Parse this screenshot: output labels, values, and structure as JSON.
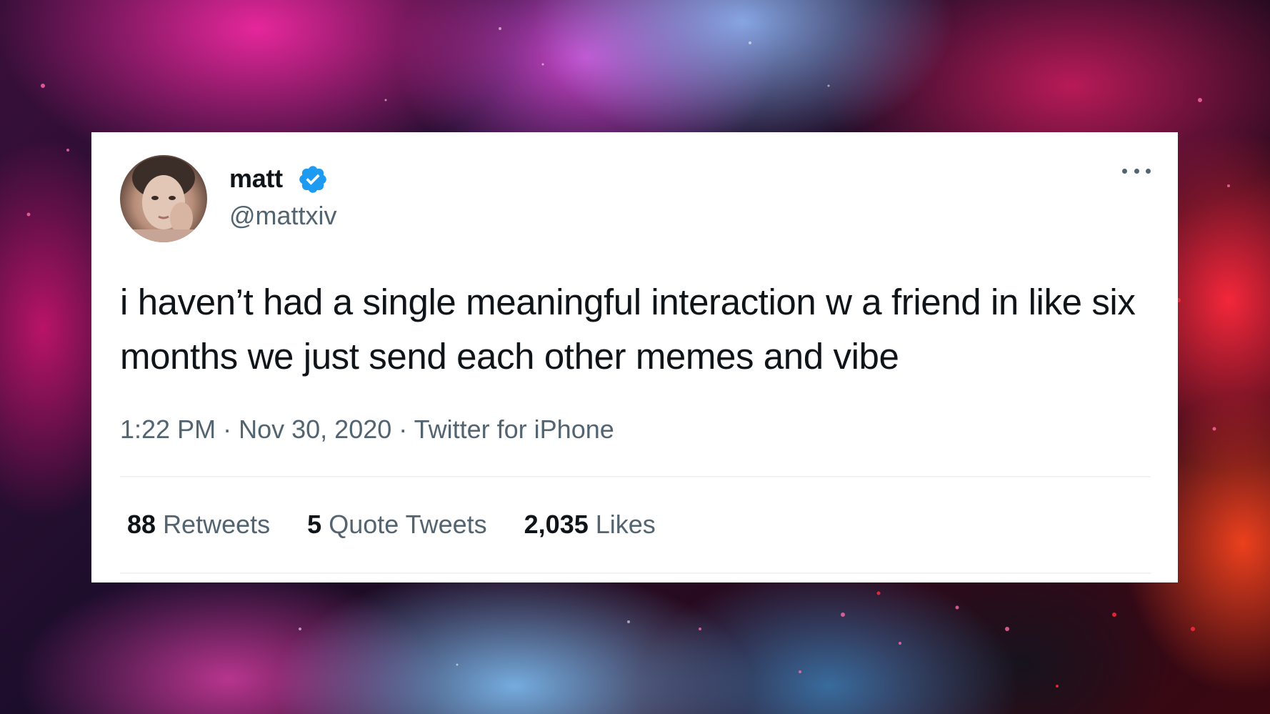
{
  "tweet": {
    "author": {
      "display_name": "matt",
      "handle": "@mattxiv",
      "verified": true
    },
    "text": "i haven’t had a single meaningful interaction w a friend in like six months we just send each other memes and vibe",
    "time": "1:22 PM",
    "date": "Nov 30, 2020",
    "source": "Twitter for iPhone",
    "separator": "·",
    "stats": {
      "retweets_count": "88",
      "retweets_label": "Retweets",
      "quotes_count": "5",
      "quotes_label": "Quote Tweets",
      "likes_count": "2,035",
      "likes_label": "Likes"
    }
  },
  "icons": {
    "verified": "verified-badge-icon",
    "more": "more-horizontal-icon"
  },
  "colors": {
    "text_primary": "#0f1419",
    "text_secondary": "#536471",
    "verified_blue": "#1d9bf0",
    "card_bg": "#ffffff"
  }
}
